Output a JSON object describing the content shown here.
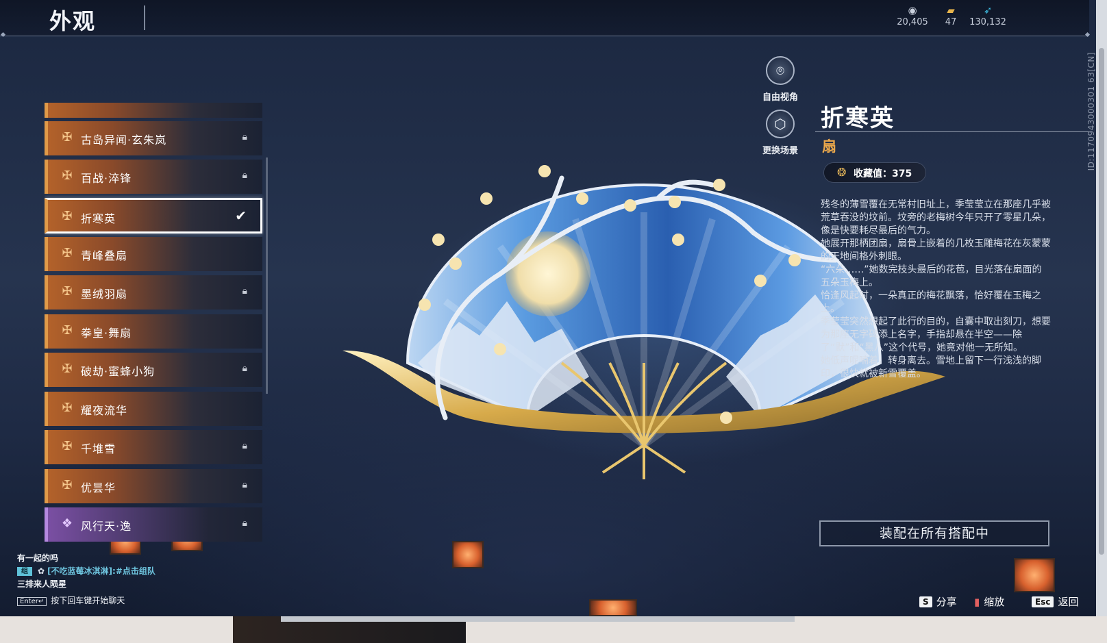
{
  "header": {
    "title": "外观",
    "currencies": [
      {
        "icon": "silver-coin-icon",
        "value": "20,405"
      },
      {
        "icon": "ticket-icon",
        "value": "47"
      },
      {
        "icon": "feather-icon",
        "value": "130,132"
      }
    ],
    "id_text": "ID:1170943000301 63[CN]"
  },
  "camera": {
    "free_view_label": "自由视角",
    "change_scene_label": "更换场景"
  },
  "list": {
    "items": [
      {
        "label": "古岛异闻·玄朱岚",
        "locked": true,
        "selected": false,
        "rarity": "orange"
      },
      {
        "label": "百战·淬锋",
        "locked": true,
        "selected": false,
        "rarity": "orange"
      },
      {
        "label": "折寒英",
        "locked": false,
        "selected": true,
        "rarity": "orange"
      },
      {
        "label": "青峰叠扇",
        "locked": false,
        "selected": false,
        "rarity": "orange"
      },
      {
        "label": "墨绒羽扇",
        "locked": true,
        "selected": false,
        "rarity": "orange"
      },
      {
        "label": "拳皇·舞扇",
        "locked": false,
        "selected": false,
        "rarity": "orange"
      },
      {
        "label": "破劫·蜜蜂小狗",
        "locked": true,
        "selected": false,
        "rarity": "orange"
      },
      {
        "label": "耀夜流华",
        "locked": false,
        "selected": false,
        "rarity": "orange"
      },
      {
        "label": "千堆雪",
        "locked": true,
        "selected": false,
        "rarity": "orange"
      },
      {
        "label": "优昙华",
        "locked": true,
        "selected": false,
        "rarity": "orange"
      },
      {
        "label": "风行天·逸",
        "locked": true,
        "selected": false,
        "rarity": "purple"
      }
    ]
  },
  "detail": {
    "name": "折寒英",
    "type": "扇",
    "collect_label": "收藏值：375",
    "description": [
      "残冬的薄雪覆在无常村旧址上，季莹莹立在那座几乎被荒草吞没的坟前。坟旁的老梅树今年只开了零星几朵，像是快要耗尽最后的气力。",
      "她展开那柄团扇，扇骨上嵌着的几枚玉雕梅花在灰蒙蒙的天地间格外刺眼。",
      "“六朵……”她数完枝头最后的花苞，目光落在扇面的五朵玉梅上。",
      "恰逢风起时，一朵真正的梅花飘落，恰好覆在玉梅之上。",
      "季莹莹突然想起了此行的目的，自囊中取出刻刀，想要为那座无字碑添上名字，手指却悬在半空——除了“默”和“黑八”这个代号，她竟对他一无所知。",
      "她低声呢喃着，转身离去。雪地上留下一行浅浅的脚印，很快就被新雪覆盖。"
    ],
    "equip_button": "装配在所有搭配中"
  },
  "chat": {
    "line1": "有一起的吗",
    "tag": "组",
    "team_text": "[不吃蓝莓冰淇淋]:#点击组队",
    "line3": "三排来人陨星",
    "enter_key": "Enter↵",
    "hint": "按下回车键开始聊天"
  },
  "footer": {
    "share_key": "S",
    "share_label": "分享",
    "zoom_label": "缩放",
    "back_key": "Esc",
    "back_label": "返回"
  }
}
